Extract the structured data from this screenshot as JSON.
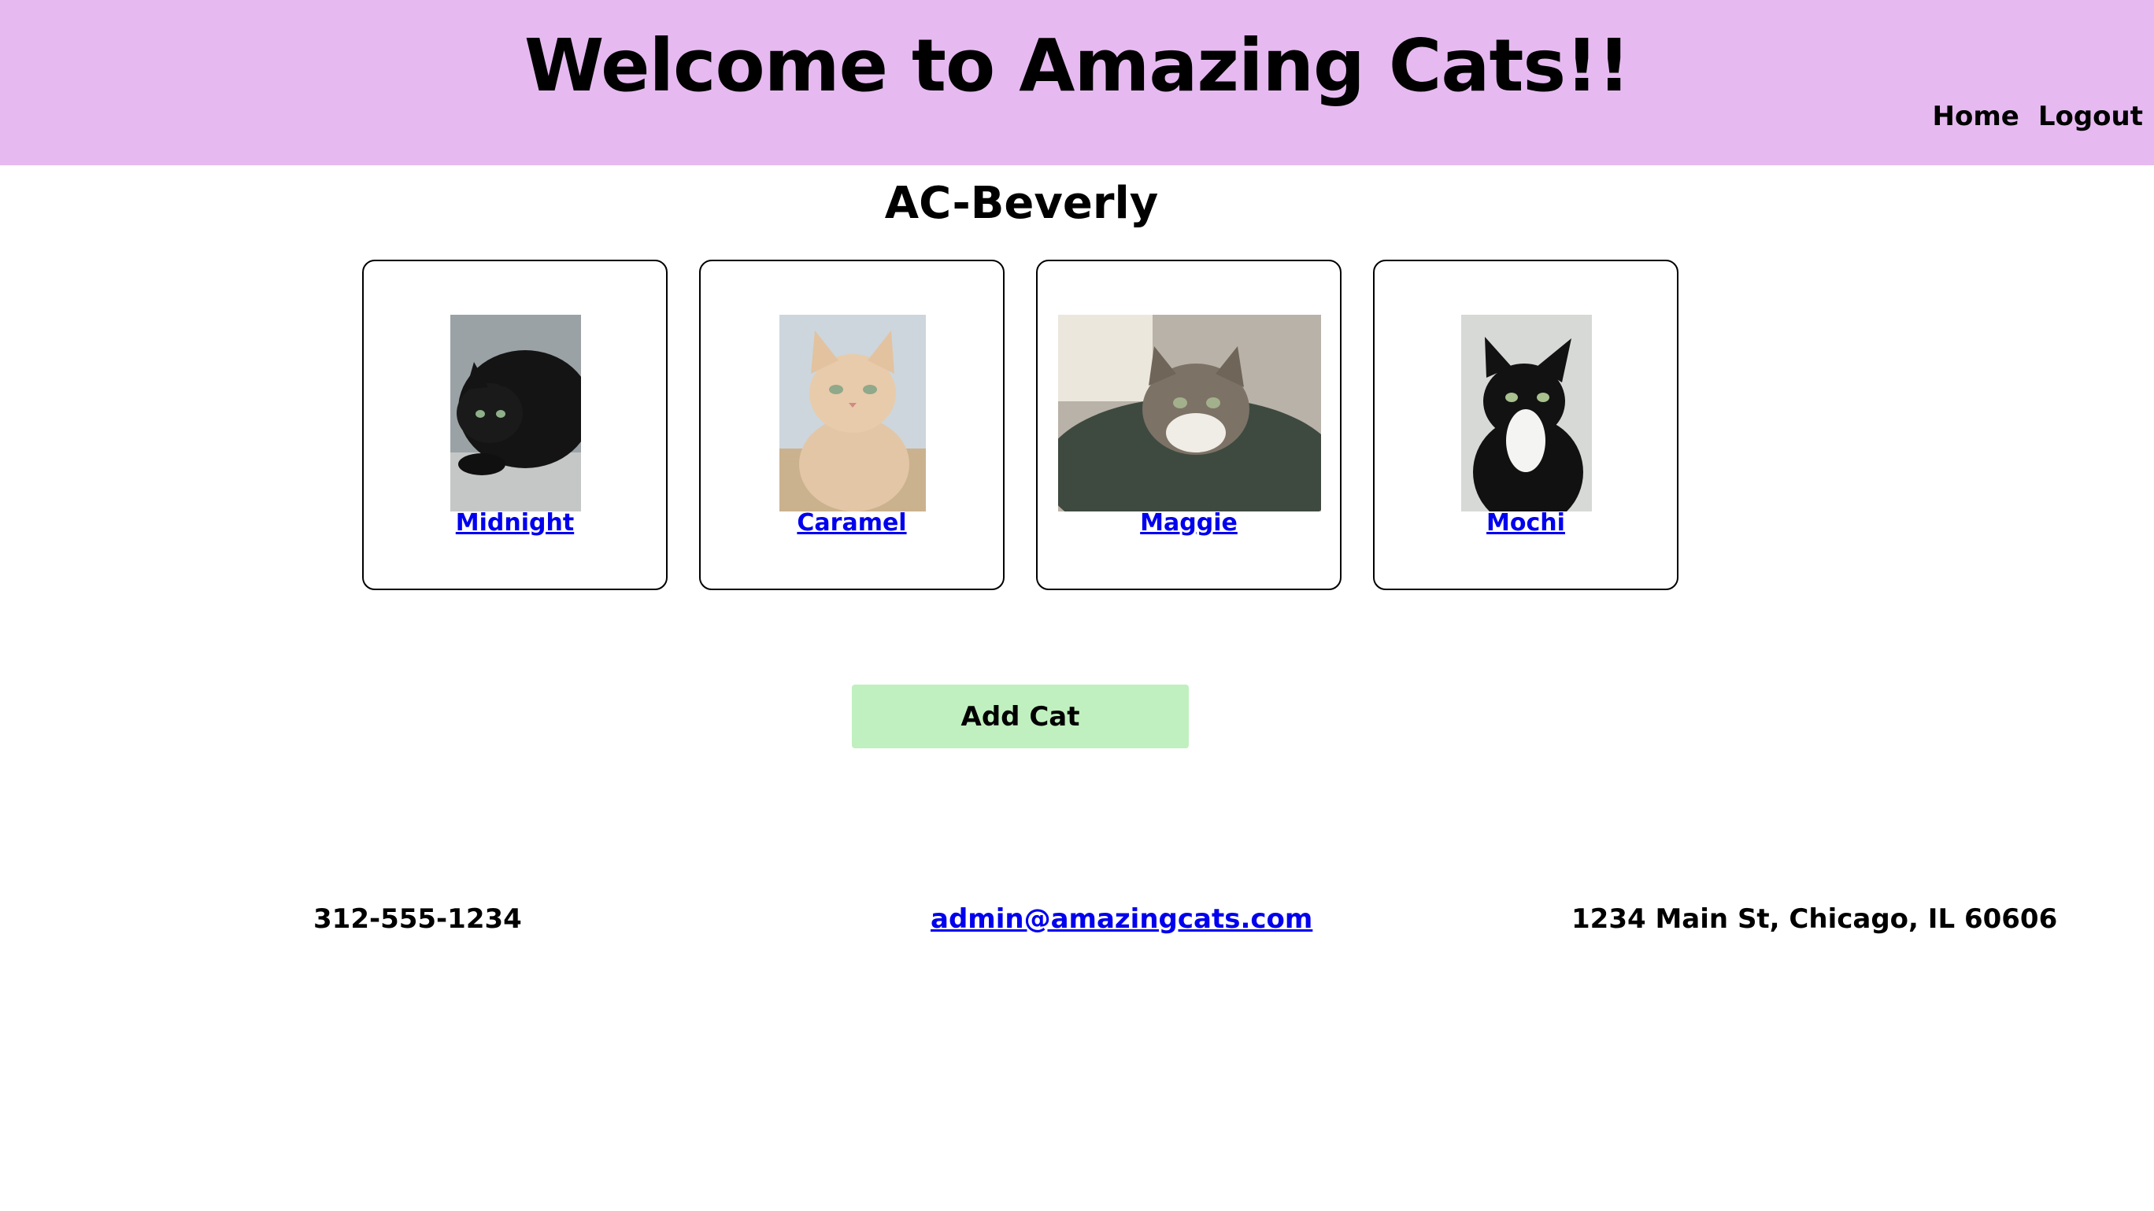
{
  "header": {
    "title": "Welcome to Amazing Cats!!",
    "nav": {
      "home": "Home",
      "logout": "Logout"
    },
    "bg_color": "#e6baf0"
  },
  "location": {
    "name": "AC-Beverly"
  },
  "cats": [
    {
      "name": "Midnight"
    },
    {
      "name": "Caramel"
    },
    {
      "name": "Maggie"
    },
    {
      "name": "Mochi"
    }
  ],
  "actions": {
    "add_cat": "Add Cat",
    "add_cat_color": "#c0f0bf"
  },
  "footer": {
    "phone": "312-555-1234",
    "email": "admin@amazingcats.com",
    "address": "1234 Main St, Chicago, IL 60606"
  }
}
